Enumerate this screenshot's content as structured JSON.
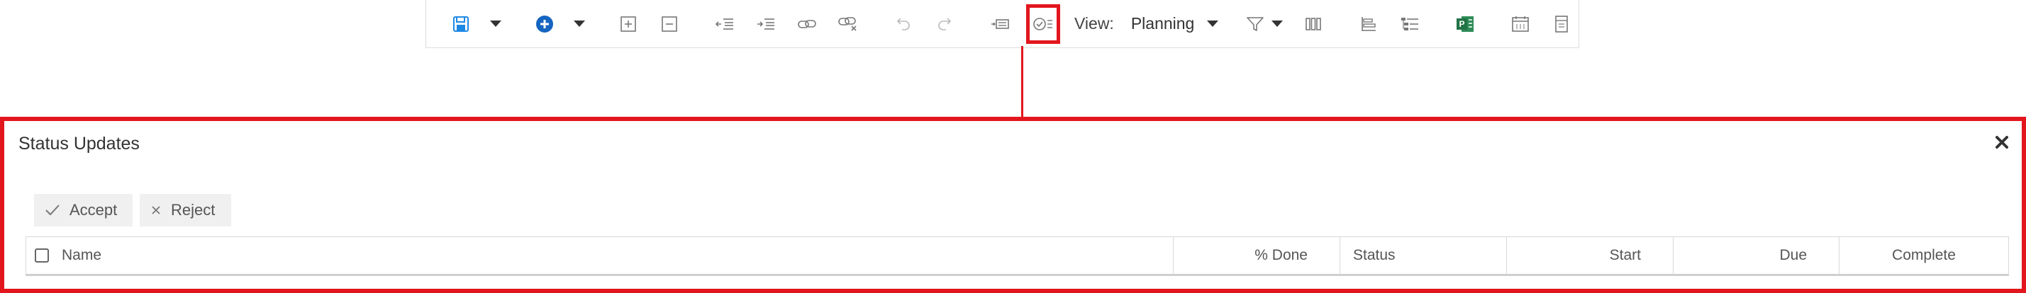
{
  "toolbar": {
    "view_label": "View:",
    "view_value": "Planning",
    "icons": [
      "save-icon",
      "dropdown-caret-icon",
      "add-circle-icon",
      "dropdown-caret-icon",
      "expand-icon",
      "collapse-icon",
      "outdent-icon",
      "indent-icon",
      "link-icon",
      "unlink-icon",
      "undo-icon",
      "redo-icon",
      "scroll-to-task-icon",
      "status-updates-icon",
      "filter-icon",
      "columns-icon",
      "gantt-bar-icon",
      "critical-path-icon",
      "project-icon",
      "calendar-icon",
      "print-icon"
    ],
    "accent_color": "#1565c0",
    "project_green": "#217346"
  },
  "panel": {
    "title": "Status Updates",
    "accept_label": "Accept",
    "reject_label": "Reject",
    "columns": {
      "name": "Name",
      "percent_done": "% Done",
      "status": "Status",
      "start": "Start",
      "due": "Due",
      "complete": "Complete"
    },
    "highlight_color": "#e3161d"
  }
}
